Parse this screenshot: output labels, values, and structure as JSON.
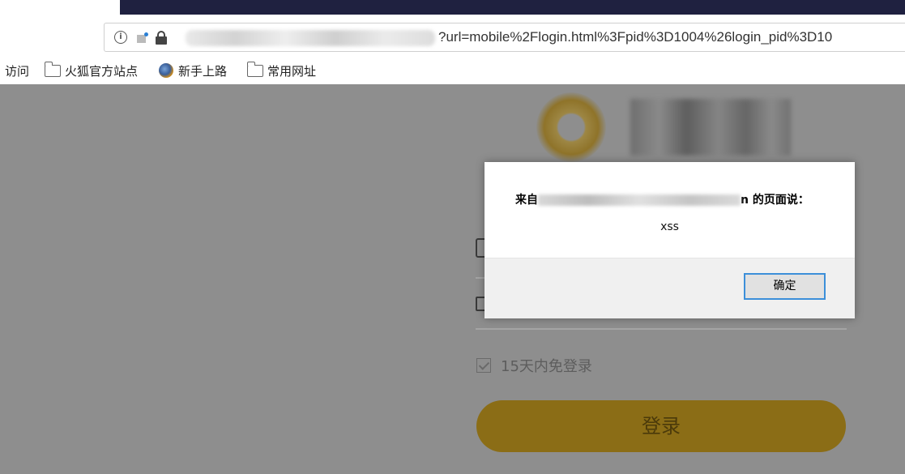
{
  "browser": {
    "url_suffix": "?url=mobile%2Flogin.html%3Fpid%3D1004%26login_pid%3D10",
    "bookmarks": [
      {
        "label": "访问"
      },
      {
        "label": "火狐官方站点"
      },
      {
        "label": "新手上路"
      },
      {
        "label": "常用网址"
      }
    ]
  },
  "login_form": {
    "remember_label": "15天内免登录",
    "login_button_label": "登录"
  },
  "alert_dialog": {
    "title_prefix": "来自",
    "title_suffix": "n 的页面说：",
    "message": "xss",
    "ok_label": "确定"
  },
  "colors": {
    "overlay_gray": "#8e8e8e",
    "login_button": "#8b6d16",
    "focus_border": "#3c8fd9"
  }
}
